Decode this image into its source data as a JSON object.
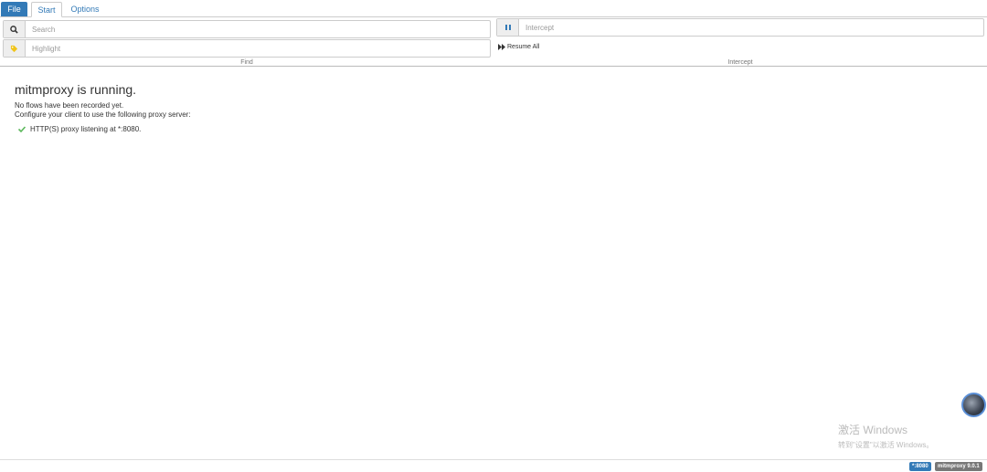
{
  "menu": {
    "tabs": [
      {
        "label": "File"
      },
      {
        "label": "Start"
      },
      {
        "label": "Options"
      }
    ]
  },
  "find": {
    "search_placeholder": "Search",
    "highlight_placeholder": "Highlight",
    "caption": "Find"
  },
  "intercept": {
    "intercept_placeholder": "Intercept",
    "resume_all_label": "Resume All",
    "caption": "Intercept"
  },
  "main": {
    "title": "mitmproxy is running.",
    "line1": "No flows have been recorded yet.",
    "line2": "Configure your client to use the following proxy server:",
    "listen": "HTTP(S) proxy listening at *:8080."
  },
  "watermark": {
    "line1": "激活 Windows",
    "line2": "转到\"设置\"以激活 Windows。"
  },
  "footer": {
    "port_badge": "*:8080",
    "version_badge": "mitmproxy 9.0.1"
  },
  "colors": {
    "accent": "#337ab7",
    "check": "#5cb85c",
    "highlight_tag": "#f0c419"
  },
  "icons": [
    "search-icon",
    "tag-icon",
    "pause-icon",
    "forward-icon",
    "check-icon"
  ]
}
